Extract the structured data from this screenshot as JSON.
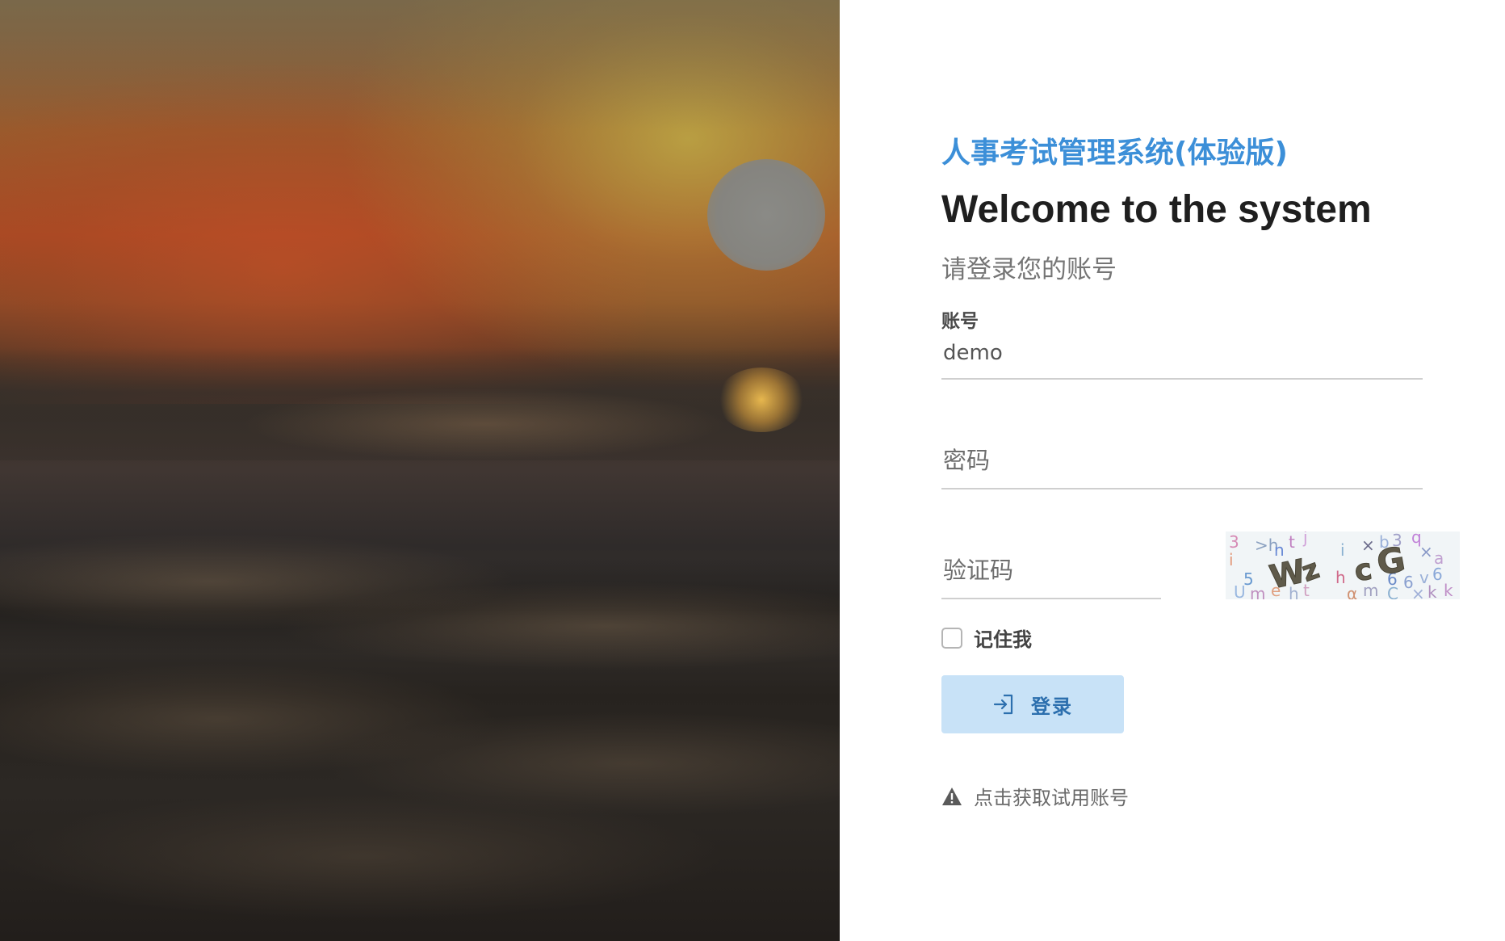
{
  "header": {
    "system_title": "人事考试管理系统(体验版)",
    "welcome": "Welcome to the system",
    "subtitle": "请登录您的账号"
  },
  "form": {
    "account": {
      "label": "账号",
      "value": "demo"
    },
    "password": {
      "placeholder": "密码",
      "value": ""
    },
    "captcha": {
      "placeholder": "验证码",
      "value": ""
    },
    "remember_me": {
      "label": "记住我",
      "checked": false
    },
    "login_button": {
      "label": "登录",
      "icon": "login-icon"
    },
    "trial_link": {
      "label": "点击获取试用账号",
      "icon": "warning-icon"
    }
  },
  "colors": {
    "title_blue": "#3c8fd8",
    "button_bg": "#c8e2f7",
    "button_text": "#2c6fae"
  }
}
